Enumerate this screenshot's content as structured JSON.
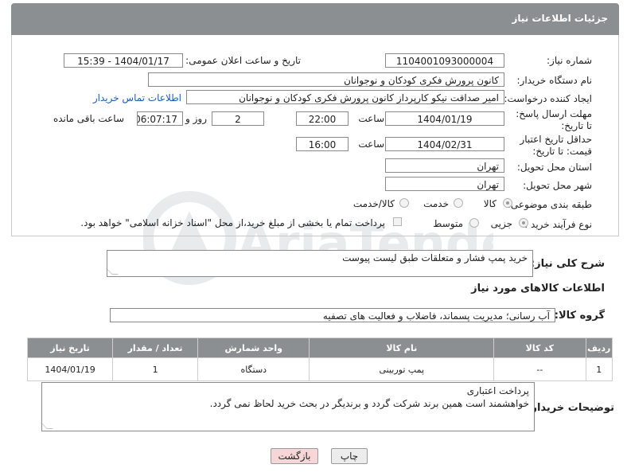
{
  "header": {
    "title": "جزئیات اطلاعات نیاز"
  },
  "form": {
    "need_number_label": "شماره نیاز:",
    "need_number": "1104001093000004",
    "announce_label": "تاریخ و ساعت اعلان عمومی:",
    "announce_value": "1404/01/17 - 15:39",
    "buyer_org_label": "نام دستگاه خریدار:",
    "buyer_org": "کانون پرورش فکری کودکان و نوجوانان",
    "creator_label": "ایجاد کننده درخواست:",
    "creator": "امیر صداقت نیکو کارپرداز کانون پرورش فکری کودکان و نوجوانان",
    "contact_link": "اطلاعات تماس خریدار",
    "deadline_label": "مهلت ارسال پاسخ: تا تاریخ:",
    "deadline_date": "1404/01/19",
    "time_label": "ساعت",
    "deadline_time": "22:00",
    "days_value": "2",
    "days_label": "روز و",
    "remaining_value": "06:07:17",
    "remaining_label": "ساعت باقی مانده",
    "validity_label": "حداقل تاریخ اعتبار قیمت: تا تاریخ:",
    "validity_date": "1404/02/31",
    "validity_time": "16:00",
    "province_label": "استان محل تحویل:",
    "province": "تهران",
    "city_label": "شهر محل تحویل:",
    "city": "تهران",
    "category_label": "طبقه بندی موضوعی:",
    "category_options": [
      "کالا",
      "خدمت",
      "کالا/خدمت"
    ],
    "process_label": "نوع فرآیند خرید :",
    "process_options": [
      "جزیی",
      "متوسط"
    ],
    "payment_note": "پرداخت تمام یا بخشی از مبلغ خرید،از محل \"اسناد خزانه اسلامی\" خواهد بود."
  },
  "description": {
    "label": "شرح کلی نیاز:",
    "value": "خرید پمپ فشار و متعلقات طبق لیست پیوست"
  },
  "goods": {
    "section_title": "اطلاعات کالاهای مورد نیاز",
    "group_label": "گروه کالا:",
    "group_value": "آب رسانی؛ مدیریت پسماند، فاضلاب و فعالیت های تصفیه",
    "columns": [
      "ردیف",
      "کد کالا",
      "نام کالا",
      "واحد شمارش",
      "تعداد / مقدار",
      "تاریخ نیاز"
    ],
    "rows": [
      [
        "1",
        "--",
        "پمپ توربینی",
        "دستگاه",
        "1",
        "1404/01/19"
      ]
    ]
  },
  "buyer_notes": {
    "label": "توضیحات خریدار:",
    "line1": "پرداخت اعتباری",
    "line2": "خواهشمند است همین برند شرکت گردد و برندیگر در بحث خرید لحاظ نمی گردد."
  },
  "buttons": {
    "print": "چاپ",
    "back": "بازگشت"
  },
  "watermark": {
    "text": "AriaTender.net"
  },
  "colors": {
    "header_bg": "#8c8f91",
    "link": "#1a5fb4",
    "back_bg": "#f6d6d6",
    "print_bg": "#ececec"
  }
}
